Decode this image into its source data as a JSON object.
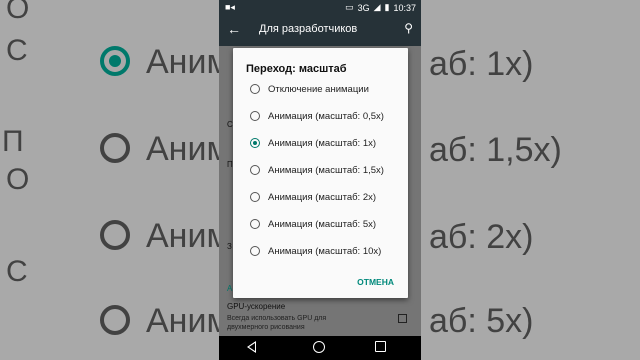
{
  "status_bar": {
    "left_icon": "video-icon",
    "network": "3G",
    "time": "10:37"
  },
  "app_bar": {
    "title": "Для разработчиков"
  },
  "dialog": {
    "title": "Переход: масштаб",
    "options": [
      {
        "label": "Отключение анимации",
        "selected": false
      },
      {
        "label": "Анимация (масштаб: 0,5x)",
        "selected": false
      },
      {
        "label": "Анимация (масштаб: 1x)",
        "selected": true
      },
      {
        "label": "Анимация (масштаб: 1,5x)",
        "selected": false
      },
      {
        "label": "Анимация (масштаб: 2x)",
        "selected": false
      },
      {
        "label": "Анимация (масштаб: 5x)",
        "selected": false
      },
      {
        "label": "Анимация (масштаб: 10x)",
        "selected": false
      }
    ],
    "cancel_label": "ОТМЕНА"
  },
  "settings": {
    "gpu_title": "GPU-ускорение",
    "gpu_summary": "Всегда использовать GPU для двухмерного рисования",
    "gpu_checked": false
  },
  "background_zoom": {
    "left_frags": [
      "О",
      "С",
      "П",
      "О",
      "С"
    ],
    "right_texts": [
      "аб: 1x)",
      "аб: 1,5x)",
      "аб: 2x)",
      "аб: 5x)"
    ],
    "left_rows": [
      {
        "text": "Аним",
        "selected": true
      },
      {
        "text": "Аним",
        "selected": false
      },
      {
        "text": "Аним",
        "selected": false
      },
      {
        "text": "Аним",
        "selected": false
      }
    ]
  },
  "colors": {
    "accent": "#00796b",
    "app_bar": "#263238"
  }
}
